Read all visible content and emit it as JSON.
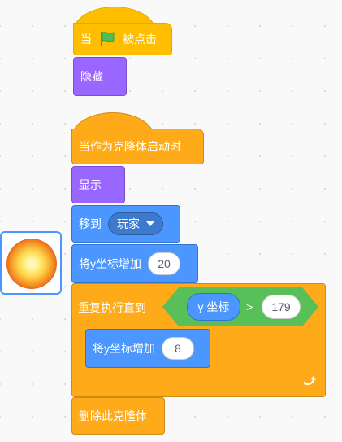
{
  "scripts": {
    "script1": {
      "when_flag": {
        "prefix": "当",
        "suffix": "被点击",
        "flag_icon": "green-flag-icon"
      },
      "hide": "隐藏"
    },
    "script2": {
      "clone_hat": "当作为克隆体启动时",
      "show": "显示",
      "goto": {
        "label": "移到",
        "target": "玩家"
      },
      "change_y_1": {
        "label": "将y坐标增加",
        "value": "20"
      },
      "repeat_until": {
        "label": "重复执行直到",
        "condition": {
          "left": "y 坐标",
          "op": ">",
          "right": "179"
        }
      },
      "change_y_2": {
        "label": "将y坐标增加",
        "value": "8"
      },
      "loop_arrow_icon": "loop-arrow-icon",
      "delete_clone": "删除此克隆体"
    }
  },
  "sprite_thumb": {
    "icon": "sun-sprite-icon"
  },
  "colors": {
    "events": "#ffbf00",
    "looks": "#9966ff",
    "motion": "#4c97ff",
    "control": "#ffab19",
    "operators": "#59c059"
  }
}
